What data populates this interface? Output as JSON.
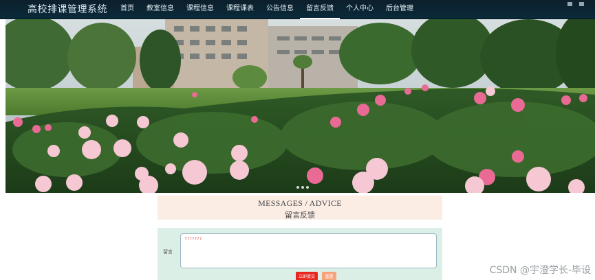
{
  "header": {
    "site_title": "高校排课管理系统",
    "nav": [
      {
        "label": "首页"
      },
      {
        "label": "教室信息"
      },
      {
        "label": "课程信息"
      },
      {
        "label": "课程课表"
      },
      {
        "label": "公告信息"
      },
      {
        "label": "留言反馈"
      },
      {
        "label": "个人中心"
      },
      {
        "label": "后台管理"
      }
    ],
    "active_index": 5
  },
  "section": {
    "title_en": "MESSAGES / ADVICE",
    "title_cn": "留言反馈"
  },
  "form": {
    "label": "留言",
    "value": "???????"
  },
  "buttons": {
    "submit": "立即提交",
    "reset": "重置"
  },
  "watermark": "CSDN @宇澄学长-毕设",
  "colors": {
    "header_bg": "#0c1f2c",
    "submit": "#e8261f",
    "reset": "#f7a27a",
    "section_bg": "#fbece4",
    "form_bg": "#dcefe6"
  }
}
